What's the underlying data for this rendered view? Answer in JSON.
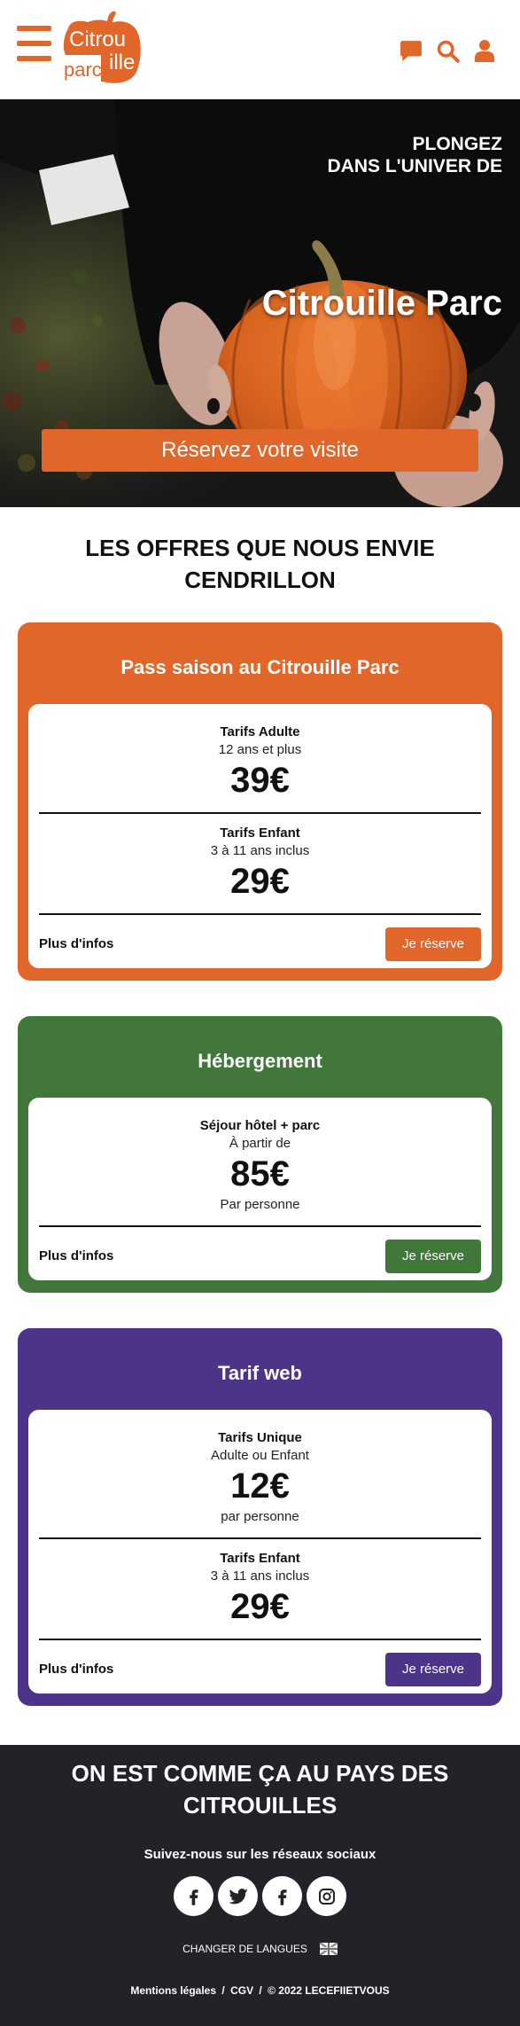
{
  "header": {
    "logo": {
      "line1": "Citrou",
      "line2_left": "parc",
      "line2_right": "ille"
    },
    "icons": {
      "menu": "hamburger-menu-icon",
      "chat": "chat-bubble-icon",
      "search": "search-icon",
      "account": "user-icon"
    }
  },
  "hero": {
    "kicker_line1": "PLONGEZ",
    "kicker_line2": "DANS L'UNIVER DE",
    "title": "Citrouille Parc",
    "cta_label": "Réservez votre visite"
  },
  "offers": {
    "title_line1": "LES OFFRES QUE NOUS ENVIE",
    "title_line2": "CENDRILLON",
    "cards": [
      {
        "title": "Pass saison au Citrouille Parc",
        "accent": "#E0662A",
        "tiers": [
          {
            "label": "Tarifs Adulte",
            "sub": "12 ans et plus",
            "price": "39€"
          },
          {
            "label": "Tarifs Enfant",
            "sub": "3 à 11 ans inclus",
            "price": "29€"
          }
        ],
        "more_label": "Plus d'infos",
        "cta_label": "Je réserve"
      },
      {
        "title": "Hébergement",
        "accent": "#41773A",
        "tiers": [
          {
            "label": "Séjour hôtel + parc",
            "sub": "À partir de",
            "price": "85€",
            "note": "Par personne"
          }
        ],
        "more_label": "Plus d'infos",
        "cta_label": "Je réserve"
      },
      {
        "title": "Tarif web",
        "accent": "#4D3488",
        "tiers": [
          {
            "label": "Tarifs Unique",
            "sub": "Adulte ou Enfant",
            "price": "12€",
            "note": "par personne"
          },
          {
            "label": "Tarifs Enfant",
            "sub": "3 à 11 ans inclus",
            "price": "29€"
          }
        ],
        "more_label": "Plus d'infos",
        "cta_label": "Je réserve"
      }
    ]
  },
  "footer": {
    "title_line1": "ON EST COMME ÇA AU PAYS DES",
    "title_line2": "CITROUILLES",
    "follow_label": "Suivez-nous sur les réseaux sociaux",
    "social_icons": [
      "facebook-icon",
      "twitter-icon",
      "facebook-icon",
      "instagram-icon"
    ],
    "language_label": "CHANGER DE LANGUES",
    "language_icon": "uk-flag-icon",
    "legal": {
      "mentions": "Mentions légales",
      "separator": "/",
      "cgv": "CGV",
      "copyright": "© 2022 LECEFIIETVOUS"
    }
  },
  "colors": {
    "brand_orange": "#E0662A",
    "footer_bg": "#212329",
    "text_dark": "#111111"
  }
}
